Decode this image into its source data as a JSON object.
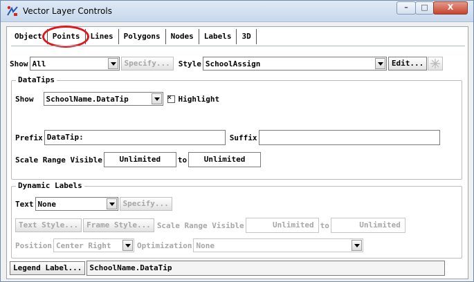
{
  "window": {
    "title": "Vector Layer Controls",
    "controls": {
      "minimize": "–",
      "maximize": "□",
      "close": "X"
    }
  },
  "tabs": [
    {
      "label": "Object"
    },
    {
      "label": "Points"
    },
    {
      "label": "Lines"
    },
    {
      "label": "Polygons"
    },
    {
      "label": "Nodes"
    },
    {
      "label": "Labels"
    },
    {
      "label": "3D"
    }
  ],
  "active_tab": "Points",
  "show_row": {
    "show_label": "Show",
    "show_value": "All",
    "specify_label": "Specify...",
    "style_label": "Style",
    "style_value": "SchoolAssign",
    "edit_label": "Edit..."
  },
  "datatips": {
    "legend": "DataTips",
    "show_label": "Show",
    "show_value": "SchoolName.DataTip",
    "highlight_label": "Highlight",
    "highlight_checked": true,
    "prefix_label": "Prefix",
    "prefix_value": "DataTip:",
    "suffix_label": "Suffix",
    "suffix_value": "",
    "scale_label": "Scale Range Visible",
    "scale_from": "Unlimited",
    "scale_to_label": "to",
    "scale_to": "Unlimited"
  },
  "dynamic_labels": {
    "legend": "Dynamic Labels",
    "text_label": "Text",
    "text_value": "None",
    "specify_label": "Specify...",
    "text_style_label": "Text Style...",
    "frame_style_label": "Frame Style...",
    "scale_label": "Scale Range Visible",
    "scale_from": "Unlimited",
    "scale_to_label": "to",
    "scale_to": "Unlimited",
    "position_label": "Position",
    "position_value": "Center Right",
    "optimization_label": "Optimization",
    "optimization_value": "None"
  },
  "legend_label": {
    "button_label": "Legend Label...",
    "value": "SchoolName.DataTip"
  },
  "colors": {
    "highlight_circle": "#e0161b",
    "disabled_text": "#a6a6a6",
    "close_button": "#c7442e"
  }
}
